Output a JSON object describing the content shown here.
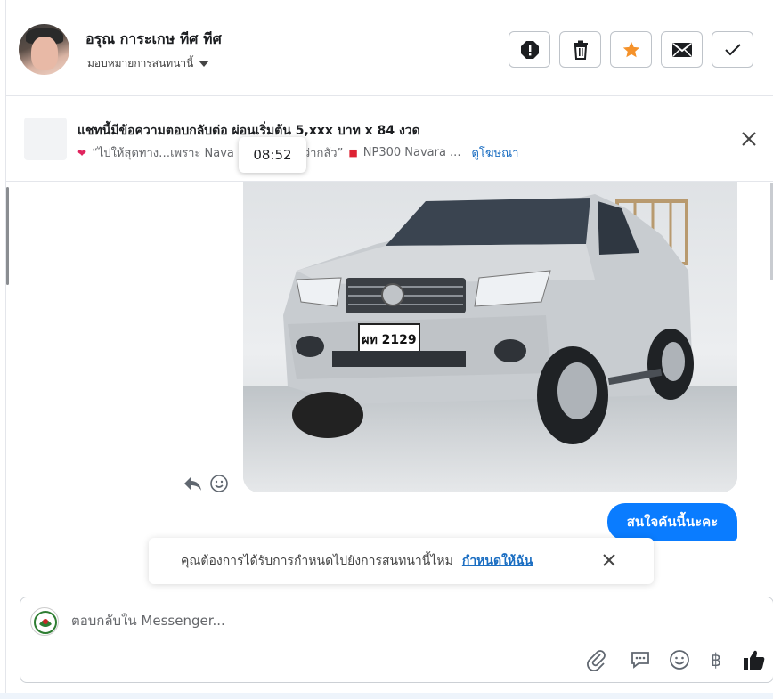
{
  "header": {
    "user_name": "อรุณ การะเกษ ทีศ ทีศ",
    "assign_label": "มอบหมายการสนทนานี้",
    "buttons": [
      {
        "name": "report",
        "icon": "alert-icon"
      },
      {
        "name": "delete",
        "icon": "trash-icon"
      },
      {
        "name": "star",
        "icon": "star-icon"
      },
      {
        "name": "mark-unread",
        "icon": "envelope-icon"
      },
      {
        "name": "mark-done",
        "icon": "check-icon"
      }
    ],
    "star_color": "#f5922a"
  },
  "ad_banner": {
    "title": "แชทนี้มีข้อความตอบกลับต่อ ผ่อนเริ่มต้น 5,xxx บาท x 84 งวด",
    "quote": "“ไปให้สุดทาง…เพราะ Nava",
    "quote_tail": "ว่ากลัว”",
    "product": "NP300 Navara ...",
    "link": "ดูโฆษณา"
  },
  "tooltip": {
    "time": "08:52"
  },
  "photo": {
    "plate_text": "ผท 2129"
  },
  "message": {
    "text": "สนใจคันนี้นะคะ",
    "bubble_color": "#0a7cff"
  },
  "assign_prompt": {
    "text": "คุณต้องการได้รับการกำหนดไปยังการสนทนานี้ไหม",
    "link": "กำหนดให้ฉัน"
  },
  "composer": {
    "placeholder": "ตอบกลับใน Messenger...",
    "tools": [
      "paperclip-icon",
      "saved-reply-icon",
      "emoji-icon",
      "baht-icon",
      "thumbs-up-icon"
    ]
  }
}
